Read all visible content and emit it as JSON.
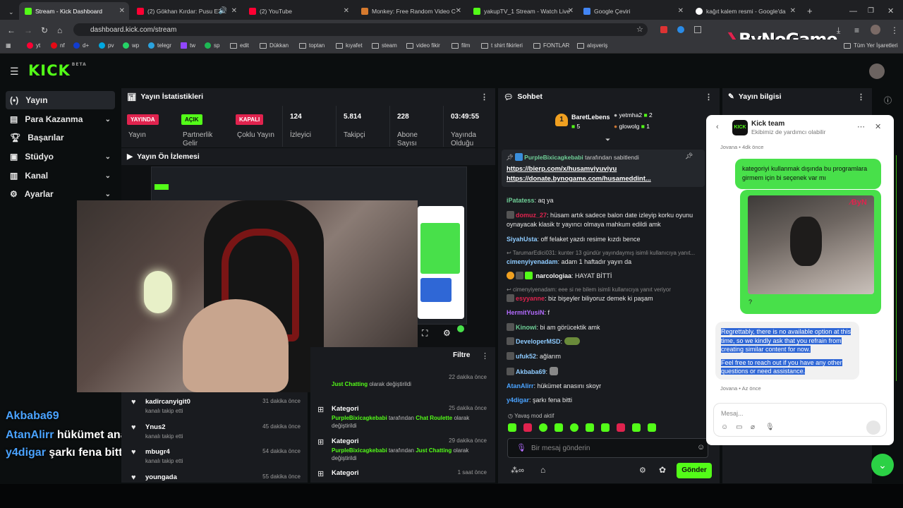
{
  "browser": {
    "tabs": [
      {
        "title": "Stream - Kick Dashboard",
        "color": "#53fc18",
        "active": true
      },
      {
        "title": "(2) Gökhan Kırdar: Pusu E3...",
        "color": "#ff0033"
      },
      {
        "title": "(2) YouTube",
        "color": "#ff0033"
      },
      {
        "title": "Monkey: Free Random Video C",
        "color": "#d67a2e"
      },
      {
        "title": "yakupTV_1 Stream - Watch Live",
        "color": "#53fc18"
      },
      {
        "title": "Google Çeviri",
        "color": "#4285f4"
      },
      {
        "title": "kağıt kalem resmi - Google'da",
        "color": "#ffffff"
      }
    ],
    "url": "dashboard.kick.com/stream",
    "bookmarks": [
      "yt",
      "nf",
      "d+",
      "pv",
      "wp",
      "telegr",
      "tw",
      "sp",
      "edit",
      "Dükkan",
      "toptan",
      "kıyafet",
      "steam",
      "video fikir",
      "film",
      "t shirt fikirleri",
      "FONTLAR",
      "alışveriş"
    ],
    "all_bookmarks": "Tüm Yer İşaretleri",
    "overlay_logo": "ByNoGame"
  },
  "kick": {
    "logo": "KICK",
    "logo_sup": "BETA",
    "sidebar": [
      {
        "label": "Yayın",
        "icon": "broadcast-icon",
        "chevron": false
      },
      {
        "label": "Para Kazanma",
        "icon": "money-icon",
        "chevron": true
      },
      {
        "label": "Başarılar",
        "icon": "trophy-icon",
        "chevron": false
      },
      {
        "label": "Stüdyo",
        "icon": "studio-icon",
        "chevron": true
      },
      {
        "label": "Kanal",
        "icon": "channel-icon",
        "chevron": true
      },
      {
        "label": "Ayarlar",
        "icon": "settings-icon",
        "chevron": true
      }
    ],
    "stats_title": "Yayın İstatistikleri",
    "stats": [
      {
        "badge": "YAYINDA",
        "badge_color": "#e0234e",
        "label": "Yayın"
      },
      {
        "badge": "AÇIK",
        "badge_color": "#53fc18",
        "label": "Partnerlik Gelir"
      },
      {
        "badge": "KAPALI",
        "badge_color": "#e0234e",
        "label": "Çoklu Yayın"
      },
      {
        "value": "124",
        "label": "İzleyici"
      },
      {
        "value": "5.814",
        "label": "Takipçi"
      },
      {
        "value": "228",
        "label": "Abone Sayısı"
      },
      {
        "value": "03:49:55",
        "label": "Yayında Olduğu"
      }
    ],
    "preview_title": "Yayın Ön İzlemesi",
    "filter_label": "Filtre",
    "follows": [
      {
        "name": "kadircanyigit0",
        "action": "kanalı takip etti",
        "time": "31 dakika önce"
      },
      {
        "name": "Ynus2",
        "action": "kanalı takip etti",
        "time": "45 dakika önce"
      },
      {
        "name": "mbugr4",
        "action": "kanalı takip etti",
        "time": "54 dakika önce"
      },
      {
        "name": "youngada",
        "action": "",
        "time": "55 dakika önce"
      }
    ],
    "categories": [
      {
        "title": "",
        "user": "",
        "mid": "",
        "cat": "Just Chatting",
        "tail": "olarak değiştirildi",
        "time": "22 dakika önce"
      },
      {
        "title": "Kategori",
        "user": "PurpleBixicagkebabi",
        "mid": "tarafından",
        "cat": "Chat Roulette",
        "tail": "olarak değiştirildi",
        "time": "25 dakika önce"
      },
      {
        "title": "Kategori",
        "user": "PurpleBixicagkebabi",
        "mid": "tarafından",
        "cat": "Just Chatting",
        "tail": "olarak değiştirildi",
        "time": "29 dakika önce"
      },
      {
        "title": "Kategori",
        "user": "",
        "mid": "",
        "cat": "",
        "tail": "",
        "time": "1 saat önce"
      }
    ],
    "chat_title": "Sohbet",
    "leaderboard": {
      "first": "BaretLebens",
      "first_count": "5",
      "second": "yetmha2",
      "second_count": "2",
      "third": "glowolg",
      "third_count": "1"
    },
    "pinned": {
      "user": "PurpleBixicagkebabi",
      "suffix": "tarafından sabitlendi",
      "link1": "https://bierp.com/x/husamviyuviyu",
      "link2": "https://donate.bynogame.com/husameddint..."
    },
    "chat": [
      {
        "user": "iPatatess",
        "color": "#6fcf97",
        "text": "aq ya",
        "reply": ""
      },
      {
        "user": "domuz_27",
        "color": "#e0234e",
        "text": "hüsam artık sadece balon date izleyip korku oyunu oynayacak klasik tr yayıncı olmaya mahkum edildi amk",
        "reply": ""
      },
      {
        "user": "SiyahUsta",
        "color": "#8ecbff",
        "text": "off felaket yazdı resime kızdı bence",
        "reply": ""
      },
      {
        "user": "cimenyiyenadam",
        "color": "#8ecbff",
        "text": "adam 1 haftadır yayın da",
        "reply": "TarumarEdici031: kunter 13 gündür yayındaymış isimli kullanıcıya yanıt..."
      },
      {
        "user": "narcologiaa",
        "color": "#f2f2f2",
        "text": "HAYAT BİTTİ",
        "reply": ""
      },
      {
        "user": "esyyanne",
        "color": "#e0234e",
        "text": "biz bişeyler biliyoruz demek ki paşam",
        "reply": "cimenyiyenadam: eee si ne bilem isimli kullanıcıya yanıt veriyor"
      },
      {
        "user": "HermitYusiN",
        "color": "#b46bff",
        "text": "f",
        "reply": ""
      },
      {
        "user": "Kinowi",
        "color": "#6fcf97",
        "text": "bi am görücektik amk",
        "reply": ""
      },
      {
        "user": "DeveloperMSD",
        "color": "#8ecbff",
        "text": "",
        "reply": ""
      },
      {
        "user": "ufuk52",
        "color": "#8ecbff",
        "text": "ağlarım",
        "reply": ""
      },
      {
        "user": "Akbaba69",
        "color": "#8ecbff",
        "text": "",
        "reply": ""
      },
      {
        "user": "AtanAlirr",
        "color": "#4aa3ff",
        "text": "hükümet anasını skoyr",
        "reply": ""
      },
      {
        "user": "y4digar",
        "color": "#4aa3ff",
        "text": "şarkı fena bitti",
        "reply": ""
      }
    ],
    "slow_mode": "Yavaş mod aktif",
    "chat_placeholder": "Bir mesaj gönderin",
    "send_label": "Gönder",
    "info_title": "Yayın bilgisi",
    "overlay_chat": [
      {
        "user": "Akbaba69",
        "text": ""
      },
      {
        "user": "AtanAlirr",
        "text": "hükümet anasını skoyr"
      },
      {
        "user": "y4digar",
        "text": "şarkı fena bitti"
      }
    ]
  },
  "support": {
    "name": "Kick team",
    "subtitle": "Ekibimiz de yardımcı olabilir",
    "meta_top": "Jovana • 4dk önce",
    "user_msg": "kategoriyi kullanmak dışında bu programlara girmem için bi seçenek var mı",
    "image_caption": "?",
    "reply1": "Regrettably, there is no available option at this time, so we kindly ask that you refrain from creating similar content for now.",
    "reply2": "Feel free to reach out if you have any other questions or need assistance.",
    "meta_bottom": "Jovana • Az önce",
    "placeholder": "Mesaj..."
  }
}
